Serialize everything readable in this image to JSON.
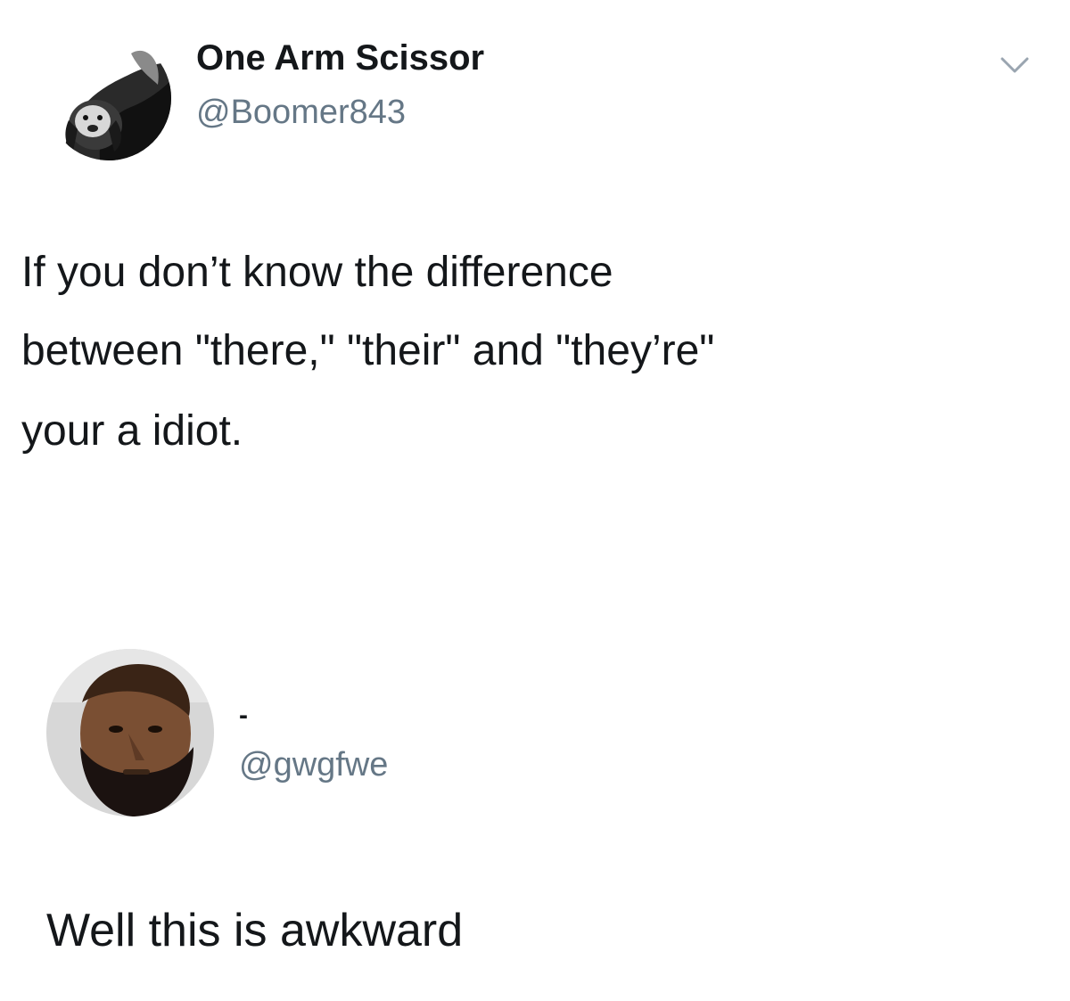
{
  "tweet": {
    "author": {
      "display_name": "One Arm Scissor",
      "handle": "@Boomer843",
      "avatar_icon": "dog-avatar-icon"
    },
    "text_lines": [
      "If you don’t know the difference",
      "between \"there,\" \"their\" and \"they’re\"",
      "your a idiot."
    ],
    "menu_icon": "chevron-down-icon"
  },
  "reply": {
    "author": {
      "display_name": "-",
      "handle": "@gwgfwe",
      "avatar_icon": "man-avatar-icon"
    },
    "text": "Well this is awkward"
  },
  "colors": {
    "text_primary": "#14171a",
    "text_secondary": "#657786",
    "background": "#ffffff"
  }
}
